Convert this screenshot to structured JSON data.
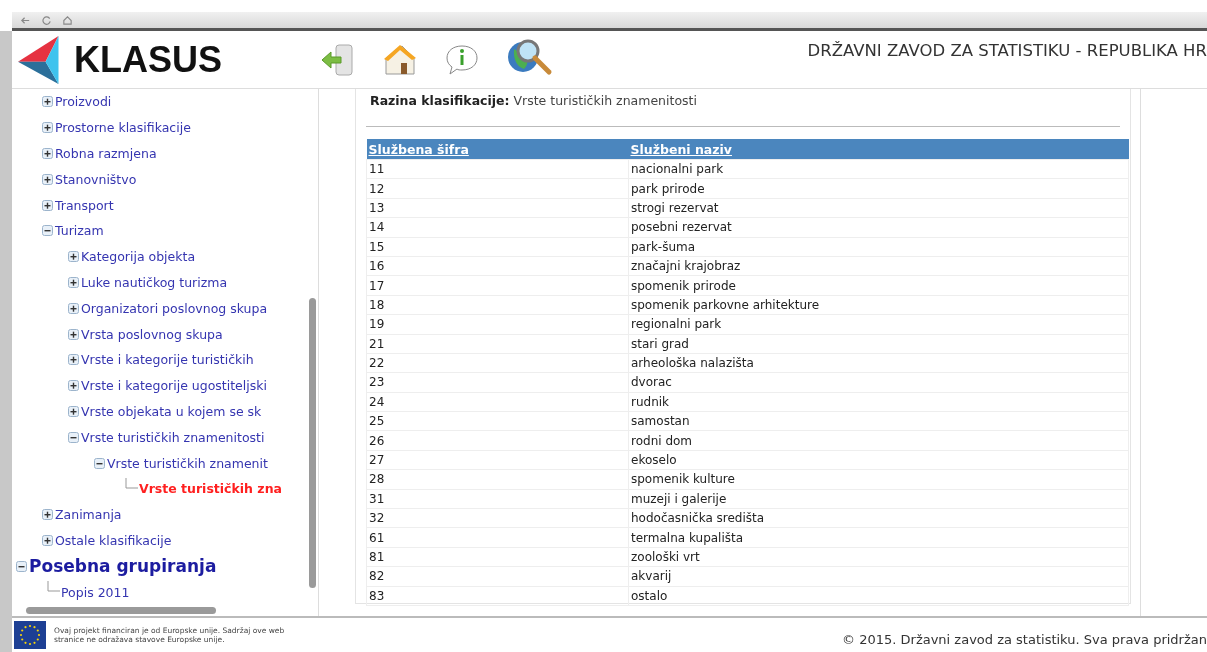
{
  "header": {
    "logo": "KLASUS",
    "title": "DRŽAVNI ZAVOD ZA STATISTIKU - REPUBLIKA HR"
  },
  "tree": [
    {
      "label": "Proizvodi",
      "expanded": false,
      "selected": false
    },
    {
      "label": "Prostorne klasifikacije",
      "expanded": false,
      "selected": false
    },
    {
      "label": "Robna razmjena",
      "expanded": false,
      "selected": false
    },
    {
      "label": "Stanovništvo",
      "expanded": false,
      "selected": false
    },
    {
      "label": "Transport",
      "expanded": false,
      "selected": false
    },
    {
      "label": "Turizam",
      "expanded": true,
      "selected": false,
      "children": [
        {
          "label": "Kategorija objekta",
          "expanded": false,
          "selected": false
        },
        {
          "label": "Luke nautičkog turizma",
          "expanded": false,
          "selected": false
        },
        {
          "label": "Organizatori poslovnog skupa",
          "expanded": false,
          "selected": false
        },
        {
          "label": "Vrsta poslovnog skupa",
          "expanded": false,
          "selected": false
        },
        {
          "label": "Vrste i kategorije turističkih",
          "expanded": false,
          "selected": false
        },
        {
          "label": "Vrste i kategorije ugostiteljski",
          "expanded": false,
          "selected": false
        },
        {
          "label": "Vrste objekata u kojem se sk",
          "expanded": false,
          "selected": false
        },
        {
          "label": "Vrste turističkih znamenitosti",
          "expanded": true,
          "selected": false,
          "children": [
            {
              "label": "Vrste turističkih znamenit",
              "expanded": true,
              "selected": false,
              "children": [
                {
                  "label": "Vrste turističkih zna",
                  "selected": true
                }
              ]
            }
          ]
        }
      ]
    },
    {
      "label": "Zanimanja",
      "expanded": false,
      "selected": false
    },
    {
      "label": "Ostale klasifikacije",
      "expanded": false,
      "selected": false
    }
  ],
  "special_groups": [
    {
      "label": "Posebna grupiranja",
      "expanded": true,
      "selected": false,
      "children": [
        {
          "label": "Popis 2011",
          "selected": false
        }
      ]
    }
  ],
  "level": {
    "label": "Razina klasifikacije:",
    "value": "Vrste turističkih znamenitosti"
  },
  "table": {
    "columns": [
      "Službena šifra",
      "Službeni naziv"
    ],
    "rows": [
      [
        "11",
        "nacionalni park"
      ],
      [
        "12",
        "park prirode"
      ],
      [
        "13",
        "strogi rezervat"
      ],
      [
        "14",
        "posebni rezervat"
      ],
      [
        "15",
        "park-šuma"
      ],
      [
        "16",
        "značajni krajobraz"
      ],
      [
        "17",
        "spomenik prirode"
      ],
      [
        "18",
        "spomenik parkovne arhitekture"
      ],
      [
        "19",
        "regionalni park"
      ],
      [
        "21",
        "stari grad"
      ],
      [
        "22",
        "arheološka nalazišta"
      ],
      [
        "23",
        "dvorac"
      ],
      [
        "24",
        "rudnik"
      ],
      [
        "25",
        "samostan"
      ],
      [
        "26",
        "rodni dom"
      ],
      [
        "27",
        "ekoselo"
      ],
      [
        "28",
        "spomenik kulture"
      ],
      [
        "31",
        "muzeji i galerije"
      ],
      [
        "32",
        "hodočasnička središta"
      ],
      [
        "61",
        "termalna kupališta"
      ],
      [
        "81",
        "zoološki vrt"
      ],
      [
        "82",
        "akvarij"
      ],
      [
        "83",
        "ostalo"
      ]
    ]
  },
  "footer": {
    "eu_note": "Ovaj projekt financiran je od Europske unije. Sadržaj ove web stranice ne odražava stavove Europske unije.",
    "copyright": "© 2015. Državni zavod za statistiku. Sva prava pridržan"
  }
}
